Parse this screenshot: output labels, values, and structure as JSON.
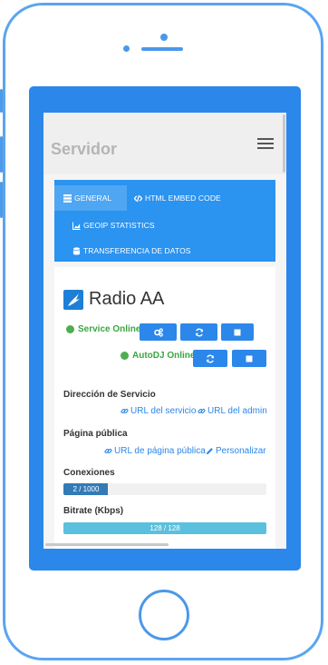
{
  "header": {
    "title": "Servidor"
  },
  "tabs": [
    {
      "label": "GENERAL",
      "icon": "list-icon",
      "active": true
    },
    {
      "label": "HTML EMBED CODE",
      "icon": "code-icon",
      "active": false
    },
    {
      "label": "GEOIP STATISTICS",
      "icon": "area-chart-icon",
      "active": false
    },
    {
      "label": "TRANSFERENCIA DE DATOS",
      "icon": "database-icon",
      "active": false
    }
  ],
  "station": {
    "name": "Radio AA"
  },
  "service": {
    "status_label": "Service Online",
    "autodj_status_label": "AutoDJ Online"
  },
  "address": {
    "label": "Dirección de Servicio",
    "service_url_label": "URL del servicio",
    "admin_url_label": "URL del admin"
  },
  "public_page": {
    "label": "Página pública",
    "page_url_label": "URL de página pública",
    "customize_label": "Personalizar"
  },
  "connections": {
    "label": "Conexiones",
    "text": "2 / 1000",
    "current": 2,
    "max": 1000
  },
  "bitrate": {
    "label": "Bitrate (Kbps)",
    "text": "128 / 128",
    "current": 128,
    "max": 128
  },
  "colors": {
    "primary": "#2b87ea",
    "online": "#3aa640",
    "frame": "#5aa5ef",
    "bitrate_bar": "#5bc0de",
    "connections_bar": "#337ab7"
  }
}
